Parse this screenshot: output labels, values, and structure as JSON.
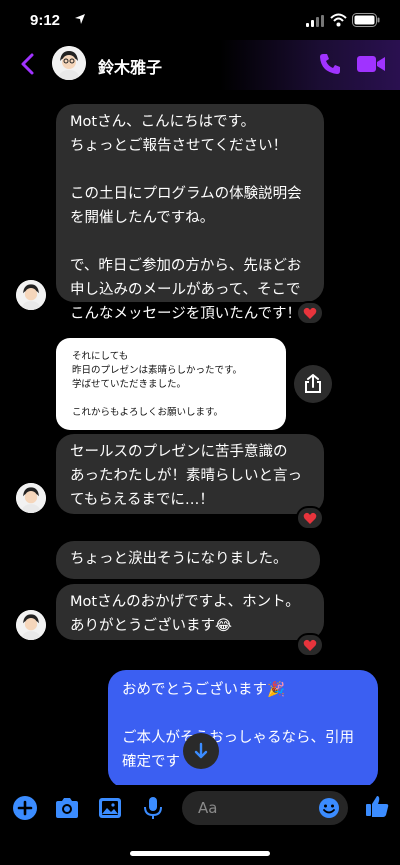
{
  "status_bar": {
    "time": "9:12"
  },
  "header": {
    "contact_name": "鈴木雅子"
  },
  "messages": [
    {
      "id": "m1",
      "text": "Motさん、こんにちはです。\nちょっとご報告させてください！\n\nこの土日にプログラムの体験説明会\nを開催したんですね。\n\nで、昨日ご参加の方から、先ほどお\n申し込みのメールがあって、そこで\nこんなメッセージを頂いたんです！",
      "reaction": "heart"
    },
    {
      "id": "m2",
      "text": "それにしても\n昨日のプレゼンは素晴らしかったです。\n学ばせていただきました。\n\nこれからもよろしくお願いします。"
    },
    {
      "id": "m3",
      "text": "セールスのプレゼンに苦手意識の\nあったわたしが！素晴らしいと言っ\nてもらえるまでに…！",
      "reaction": "heart"
    },
    {
      "id": "m4a",
      "text": "ちょっと涙出そうになりました。"
    },
    {
      "id": "m4b",
      "text": "Motさんのおかげですよ、ホント。\nありがとうございます😂",
      "reaction": "heart"
    },
    {
      "id": "m5",
      "text": "おめでとうございます🎉\n\nご本人がそうおっしゃるなら、引用\n確定です"
    }
  ],
  "composer": {
    "placeholder": "Aa"
  },
  "colors": {
    "accent": "#a033ff",
    "blue_icon": "#3b8cff",
    "outgoing": "#3b5ff2",
    "incoming": "#2e2e2e"
  }
}
